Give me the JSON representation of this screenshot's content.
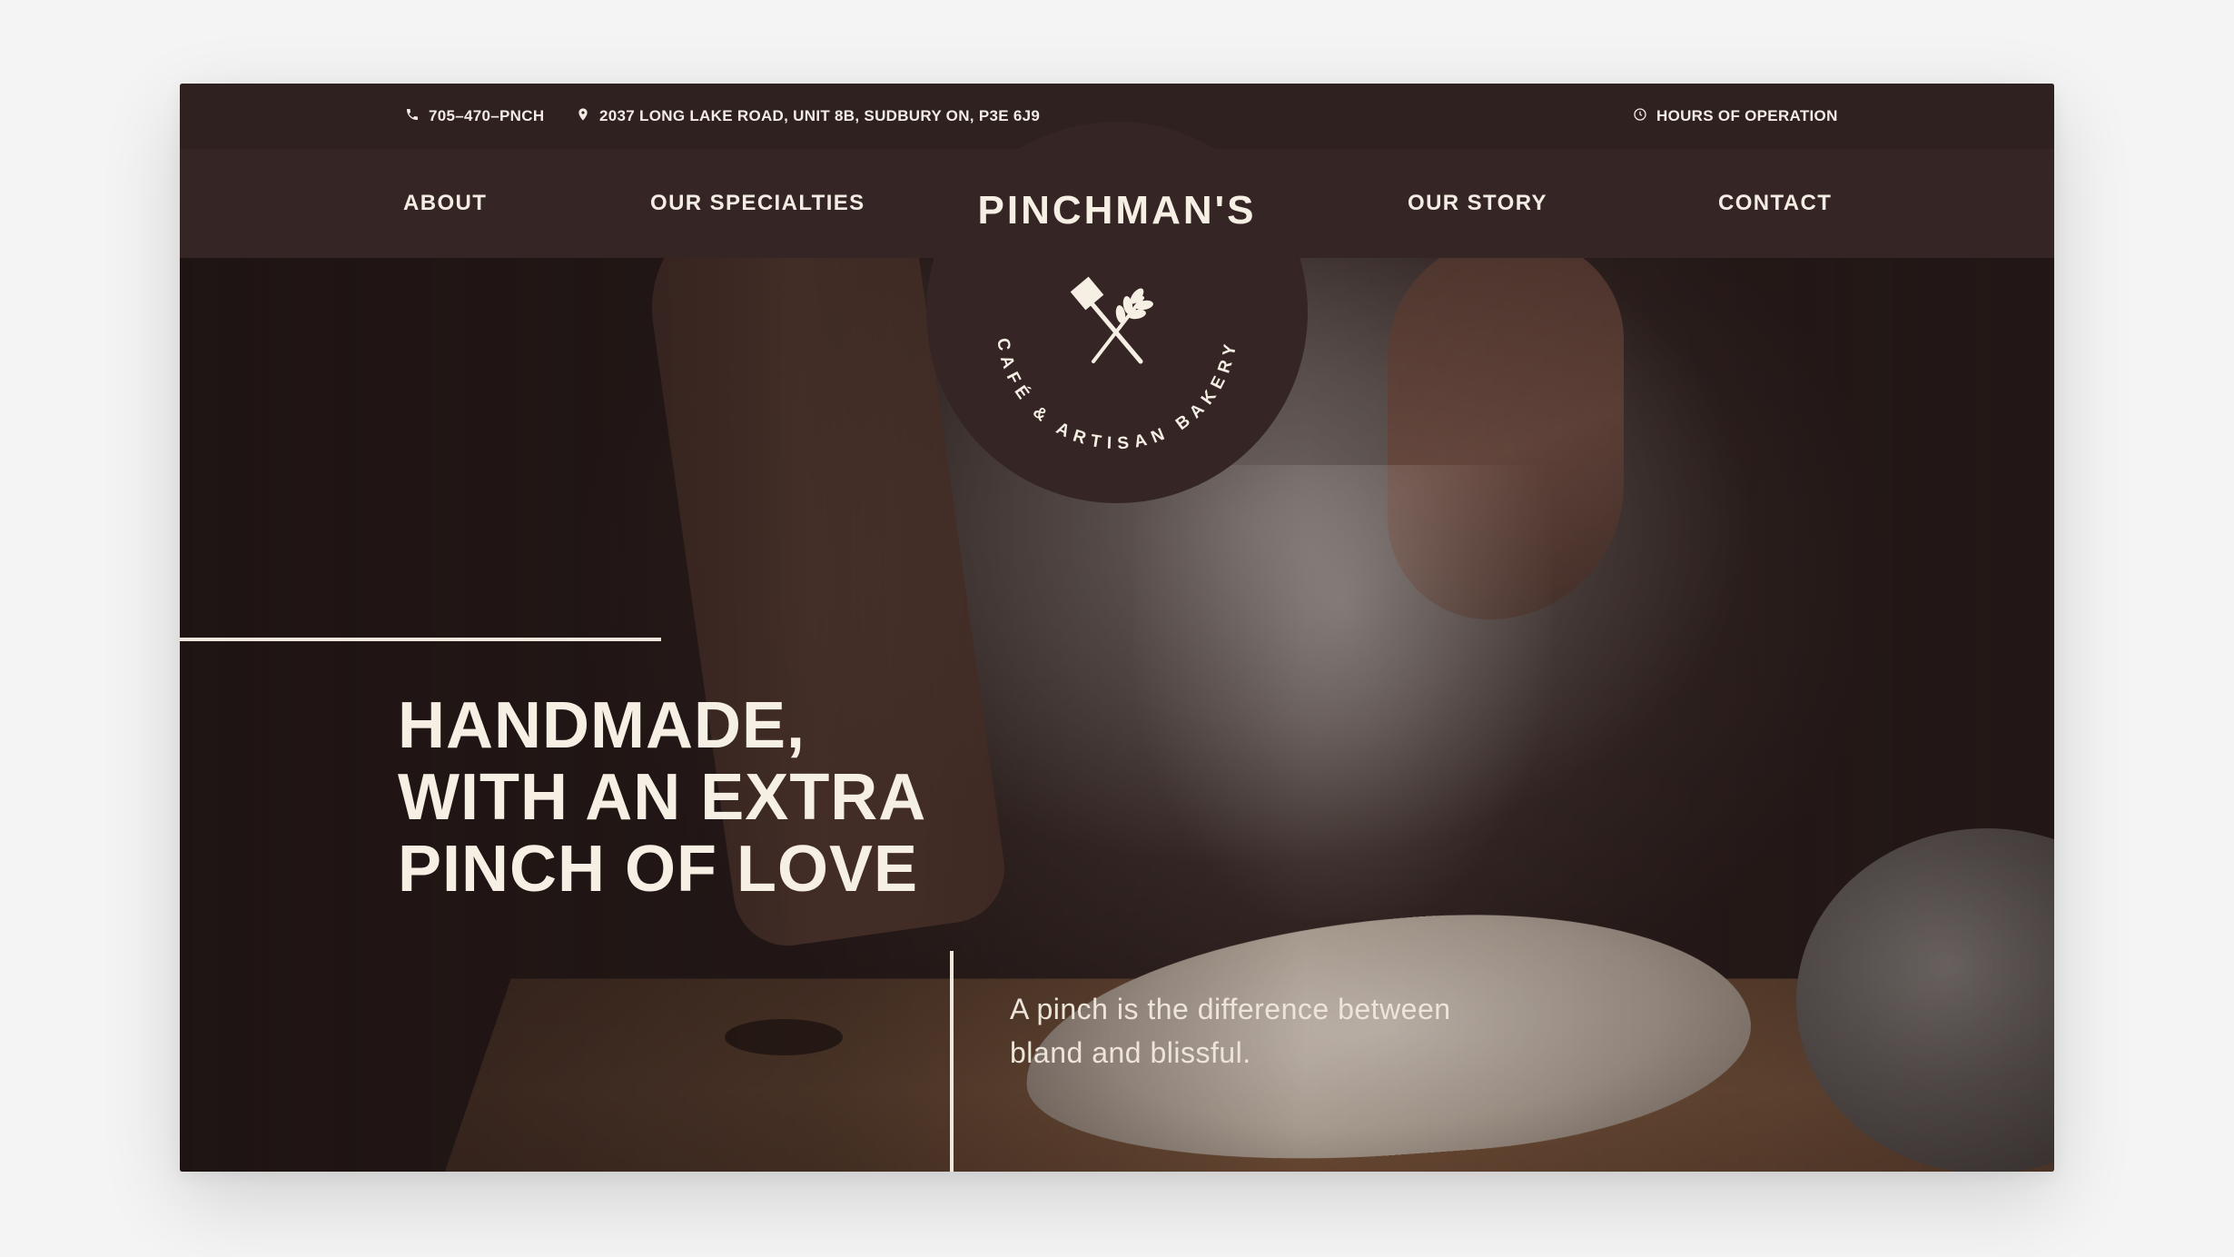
{
  "topbar": {
    "phone": "705–470–PNCH",
    "address": "2037 LONG LAKE ROAD, UNIT 8B, SUDBURY ON, P3E 6J9",
    "hours_link": "HOURS OF OPERATION"
  },
  "nav": {
    "items": [
      {
        "label": "ABOUT"
      },
      {
        "label": "OUR SPECIALTIES"
      },
      {
        "label": "OUR STORY"
      },
      {
        "label": "CONTACT"
      }
    ]
  },
  "logo": {
    "name": "PINCHMAN'S",
    "arc_text": "CAFÉ & ARTISAN BAKERY"
  },
  "hero": {
    "headline_lines": [
      "HANDMADE,",
      "WITH AN EXTRA",
      "PINCH OF LOVE"
    ],
    "tagline_lines": [
      "A pinch is the difference between",
      "bland and blissful."
    ]
  },
  "colors": {
    "background": "#f4f4f4",
    "topbar": "#2e2120",
    "nav": "#352625",
    "text_cream": "#f6efe4"
  },
  "icons": [
    "phone-icon",
    "map-pin-icon",
    "clock-icon",
    "shovel-icon",
    "wheat-icon"
  ]
}
